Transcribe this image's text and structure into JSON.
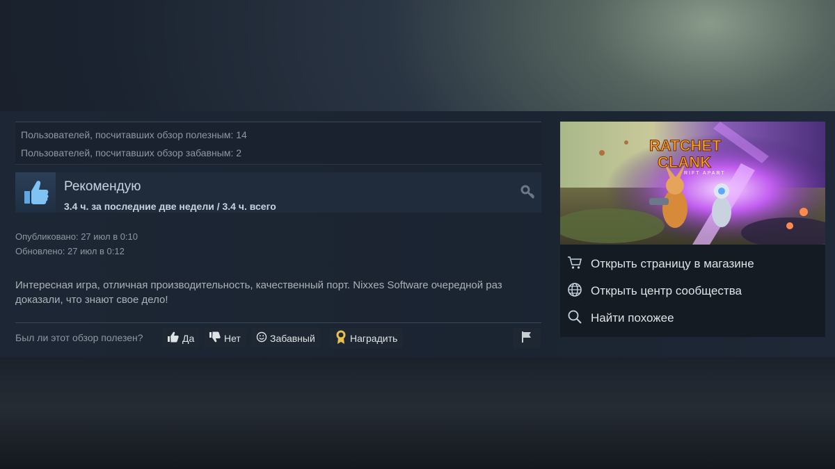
{
  "votes": {
    "helpful": "Пользователей, посчитавших обзор полезным: 14",
    "funny": "Пользователей, посчитавших обзор забавным: 2"
  },
  "review": {
    "verdict": "Рекомендую",
    "hours": "3.4 ч. за последние две недели / 3.4 ч. всего",
    "posted": "Опубликовано: 27 июл в 0:10",
    "updated": "Обновлено: 27 июл в 0:12",
    "text": "Интересная игра, отличная производительность, качественный порт. Nixxes Software очередной раз доказали, что знают свое дело!"
  },
  "feedback": {
    "question": "Был ли этот обзор полезен?",
    "yes": "Да",
    "no": "Нет",
    "funny": "Забавный",
    "award": "Наградить"
  },
  "game": {
    "logo_line1": "RATCHET",
    "logo_line2": "CLANK",
    "logo_line3": "RIFT APART"
  },
  "sidebar": {
    "store": "Открыть страницу в магазине",
    "community": "Открыть центр сообщества",
    "similar": "Найти похожее"
  },
  "icons": {
    "thumb": "thumbs-up-icon",
    "key": "key-icon",
    "flag": "flag-icon",
    "cart": "cart-icon",
    "globe": "globe-icon",
    "search": "search-icon"
  },
  "colors": {
    "accent": "#66c0f4",
    "award_gold": "#e8c14b"
  }
}
